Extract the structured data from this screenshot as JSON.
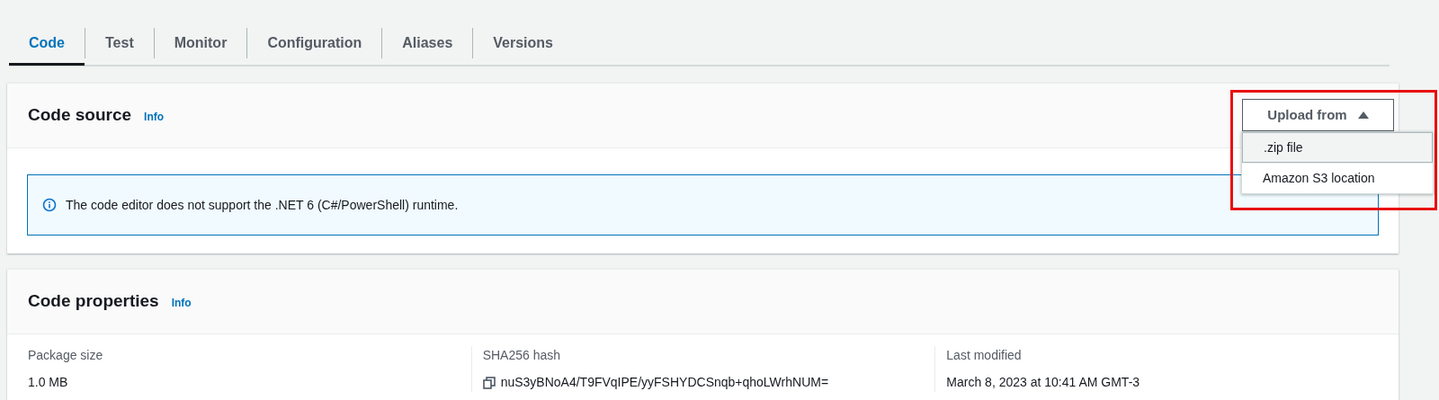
{
  "tabs": [
    {
      "label": "Code",
      "selected": true
    },
    {
      "label": "Test",
      "selected": false
    },
    {
      "label": "Monitor",
      "selected": false
    },
    {
      "label": "Configuration",
      "selected": false
    },
    {
      "label": "Aliases",
      "selected": false
    },
    {
      "label": "Versions",
      "selected": false
    }
  ],
  "code_source": {
    "title": "Code source",
    "info": "Info",
    "alert": "The code editor does not support the .NET 6 (C#/PowerShell) runtime.",
    "upload_button": {
      "label": "Upload from",
      "expanded": true
    },
    "menu": [
      {
        "label": ".zip file",
        "selected": true
      },
      {
        "label": "Amazon S3 location",
        "selected": false
      }
    ]
  },
  "code_properties": {
    "title": "Code properties",
    "info": "Info",
    "fields": [
      {
        "label": "Package size",
        "value": "1.0 MB",
        "kind": "text"
      },
      {
        "label": "SHA256 hash",
        "value": "nuS3yBNoA4/T9FVqIPE/yyFSHYDCSnqb+qhoLWrhNUM=",
        "kind": "copy"
      },
      {
        "label": "Last modified",
        "value": "March 8, 2023 at 10:41 AM GMT-3",
        "kind": "text"
      }
    ]
  }
}
